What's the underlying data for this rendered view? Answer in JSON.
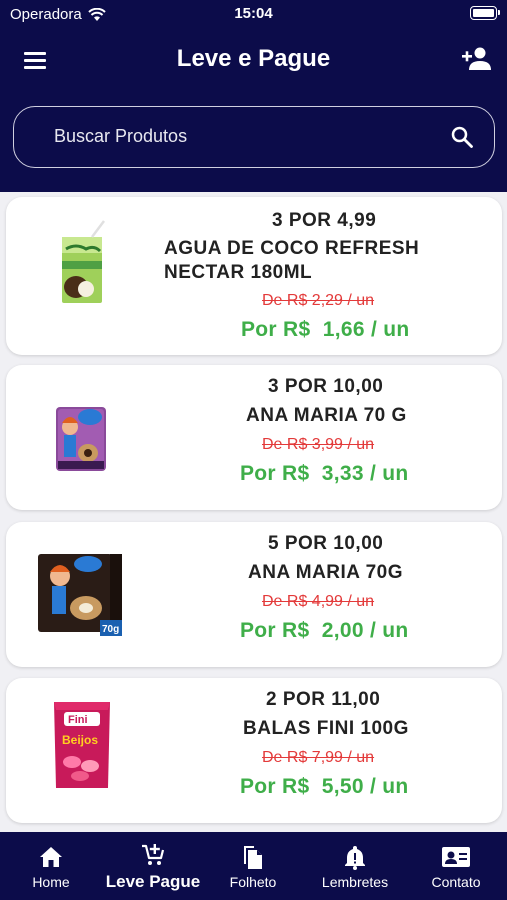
{
  "status_bar": {
    "carrier": "Operadora",
    "time": "15:04"
  },
  "header": {
    "title": "Leve e Pague",
    "menu_icon": "hamburger-menu-icon",
    "add_user_icon": "person-add-icon"
  },
  "search": {
    "placeholder": "Buscar Produtos",
    "icon": "search-icon"
  },
  "products": [
    {
      "promo": "3 POR 4,99",
      "name": "AGUA DE COCO REFRESH NECTAR 180ML",
      "old_price": "De R$  2,29 / un",
      "new_price": "Por R$  1,66 / un"
    },
    {
      "promo": "3 POR 10,00",
      "name": "ANA MARIA 70 G",
      "old_price": "De R$  3,99 / un",
      "new_price": "Por R$  3,33 / un"
    },
    {
      "promo": "5 POR 10,00",
      "name": "ANA MARIA 70G",
      "old_price": "De R$  4,99 / un",
      "new_price": "Por R$  2,00 / un"
    },
    {
      "promo": "2 POR 11,00",
      "name": "BALAS FINI 100G",
      "old_price": "De R$  7,99 / un",
      "new_price": "Por R$  5,50 / un"
    }
  ],
  "tabbar": {
    "tabs": [
      {
        "label": "Home",
        "icon": "home-icon"
      },
      {
        "label": "Leve Pague",
        "icon": "cart-add-icon"
      },
      {
        "label": "Folheto",
        "icon": "documents-icon"
      },
      {
        "label": "Lembretes",
        "icon": "bell-alert-icon"
      },
      {
        "label": "Contato",
        "icon": "contact-card-icon"
      }
    ],
    "active_tab": "Leve Pague"
  },
  "colors": {
    "navy": "#0c0c4a",
    "promo_green": "#3fae49",
    "old_price_red": "#e33a3a"
  }
}
